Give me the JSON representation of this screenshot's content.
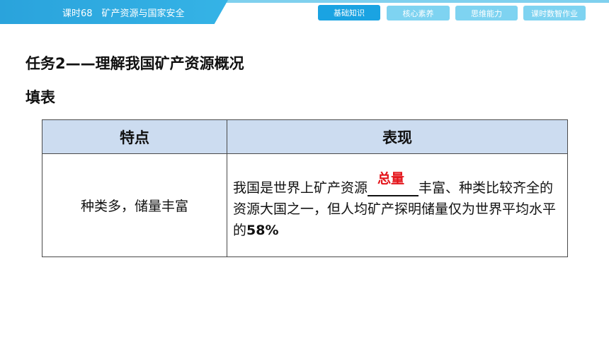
{
  "header": {
    "lesson_title": "课时68　矿产资源与国家安全",
    "tabs": [
      {
        "label": "基础知识",
        "active": true
      },
      {
        "label": "核心素养",
        "active": false
      },
      {
        "label": "思维能力",
        "active": false
      },
      {
        "label": "课时数智作业",
        "active": false
      }
    ]
  },
  "content": {
    "task_heading": "任务2——理解我国矿产资源概况",
    "sub_heading": "填表",
    "table": {
      "headers": [
        "特点",
        "表现"
      ],
      "rows": [
        {
          "feature": "种类多，储量丰富",
          "desc_before": "我国是世界上矿产资源",
          "blank_answer": "总量",
          "desc_after": "丰富、种类比较齐全的资源大国之一，但人均矿产探明储量仅为世界平均水平的",
          "percent": "58%"
        }
      ]
    }
  },
  "colors": {
    "banner": "#2aa3dc",
    "tab_active": "#1aa3e2",
    "tab_inactive": "#7ed3f1",
    "table_header_bg": "#ccdcf0",
    "answer_red": "#e4151b"
  }
}
